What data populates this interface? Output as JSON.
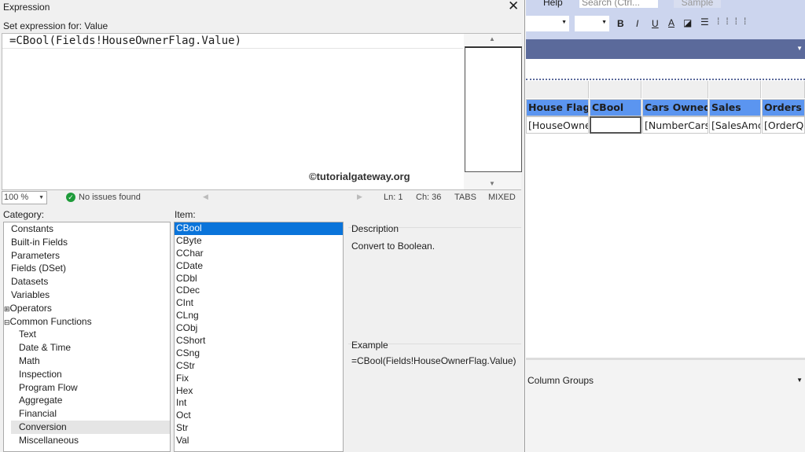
{
  "dialog": {
    "title": "Expression",
    "set_label": "Set expression for: Value",
    "expression": "=CBool(Fields!HouseOwnerFlag.Value)",
    "watermark": "©tutorialgateway.org",
    "status": {
      "zoom": "100 %",
      "issues": "No issues found",
      "ln": "Ln: 1",
      "ch": "Ch: 36",
      "tabs": "TABS",
      "mixed": "MIXED"
    },
    "category_label": "Category:",
    "item_label": "Item:",
    "categories": [
      "Constants",
      "Built-in Fields",
      "Parameters",
      "Fields (DSet)",
      "Datasets",
      "Variables",
      "Operators",
      "Common Functions",
      "Text",
      "Date & Time",
      "Math",
      "Inspection",
      "Program Flow",
      "Aggregate",
      "Financial",
      "Conversion",
      "Miscellaneous"
    ],
    "items": [
      "CBool",
      "CByte",
      "CChar",
      "CDate",
      "CDbl",
      "CDec",
      "CInt",
      "CLng",
      "CObj",
      "CShort",
      "CSng",
      "CStr",
      "Fix",
      "Hex",
      "Int",
      "Oct",
      "Str",
      "Val"
    ],
    "description_label": "Description",
    "description": "Convert to Boolean.",
    "example_label": "Example",
    "example": "=CBool(Fields!HouseOwnerFlag.Value)"
  },
  "ide": {
    "menu_help": "Help",
    "search_placeholder": "Search (Ctrl...",
    "sample": "Sample",
    "bold": "B",
    "italic": "I",
    "underline": "U",
    "font_color": "A",
    "headers": [
      "House Flag",
      "CBool",
      "Cars Owned",
      "Sales",
      "Orders"
    ],
    "cells": [
      "[HouseOwne",
      "",
      "[NumberCars",
      "[SalesAmc",
      "[OrderQ"
    ],
    "column_groups": "Column Groups"
  }
}
